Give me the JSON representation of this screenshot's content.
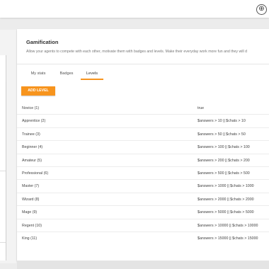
{
  "topbar": {
    "add_icon_glyph": "⊕"
  },
  "section": {
    "title": "Gamification",
    "description": "Allow your agents to compete with each other, motivate them with badges and levels. Make their everyday work more fun and they will d"
  },
  "tabs": [
    {
      "label": "My stats",
      "active": false
    },
    {
      "label": "Badges",
      "active": false
    },
    {
      "label": "Levels",
      "active": true
    }
  ],
  "add_level_label": "ADD LEVEL",
  "levels": [
    {
      "name": "Novice (1)",
      "condition": "true"
    },
    {
      "name": "Apprentice (2)",
      "condition": "$answers > 10 || $chats > 10"
    },
    {
      "name": "Trainee (3)",
      "condition": "$answers > 50 || $chats > 50"
    },
    {
      "name": "Beginner (4)",
      "condition": "$answers > 100 || $chats > 100"
    },
    {
      "name": "Amateur (5)",
      "condition": "$answers > 200 || $chats > 200"
    },
    {
      "name": "Professional (6)",
      "condition": "$answers > 500 || $chats > 500"
    },
    {
      "name": "Master (7)",
      "condition": "$answers > 1000 || $chats > 1000"
    },
    {
      "name": "Wizard (8)",
      "condition": "$answers > 2000 || $chats > 2000"
    },
    {
      "name": "Mage (9)",
      "condition": "$answers > 5000 || $chats > 5000"
    },
    {
      "name": "Regent (10)",
      "condition": "$answers > 10000 || $chats > 10000"
    },
    {
      "name": "King (11)",
      "condition": "$answers > 15000 || $chats > 15000"
    }
  ],
  "colors": {
    "accent": "#f7941d"
  }
}
